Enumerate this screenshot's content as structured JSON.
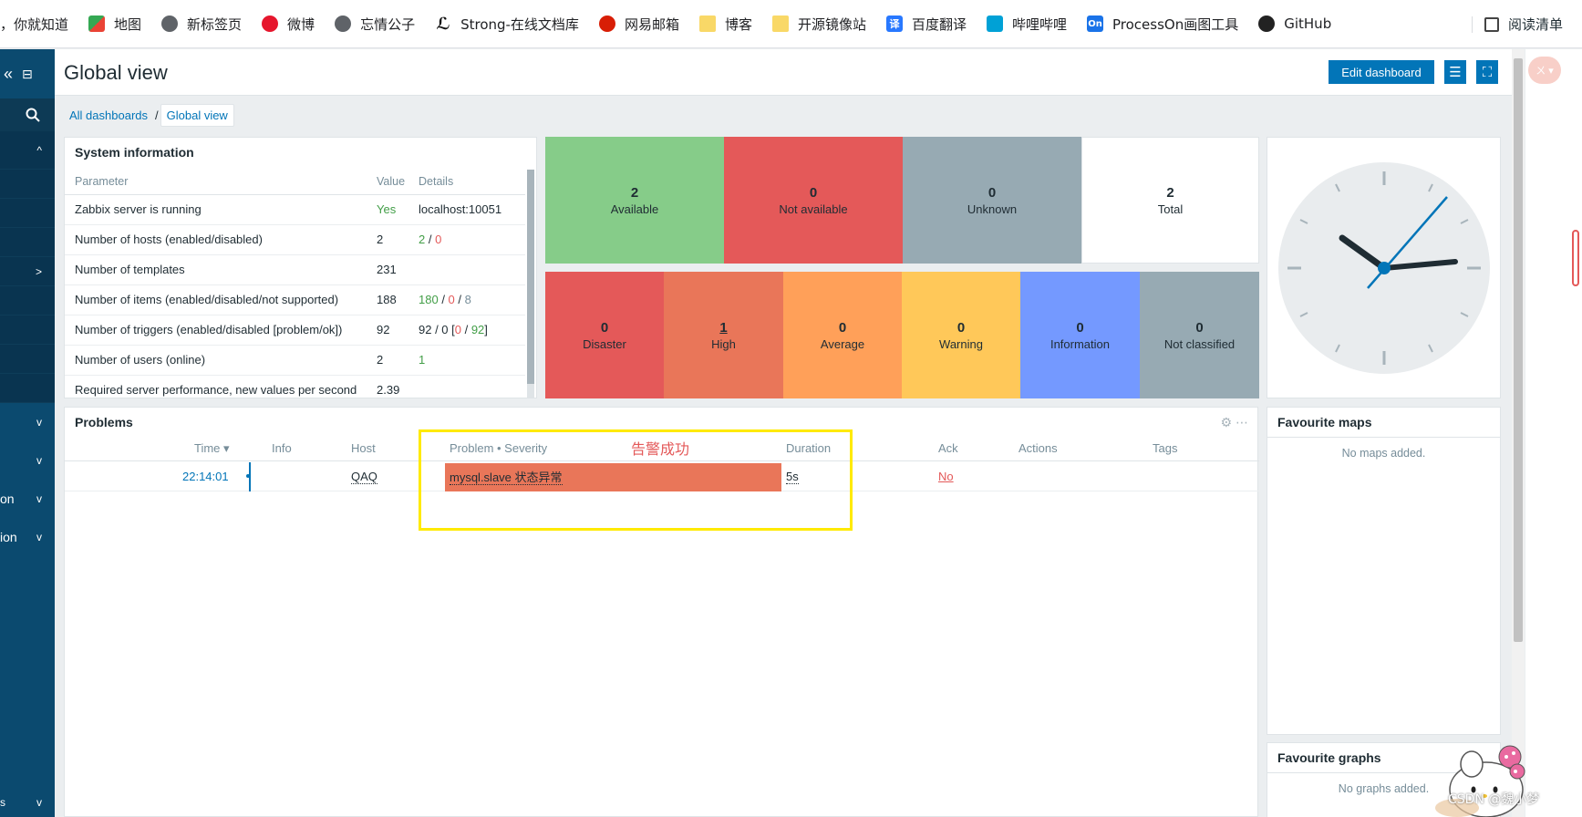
{
  "bookmarks": [
    {
      "label": "，你就知道",
      "icon": "none"
    },
    {
      "label": "地图",
      "icon": "map"
    },
    {
      "label": "新标签页",
      "icon": "globe"
    },
    {
      "label": "微博",
      "icon": "weibo"
    },
    {
      "label": "忘情公子",
      "icon": "globe"
    },
    {
      "label": "Strong-在线文档库",
      "icon": "strong"
    },
    {
      "label": "网易邮箱",
      "icon": "mail"
    },
    {
      "label": "博客",
      "icon": "folder"
    },
    {
      "label": "开源镜像站",
      "icon": "folder"
    },
    {
      "label": "百度翻译",
      "icon": "fanyi"
    },
    {
      "label": "哔哩哔哩",
      "icon": "bili"
    },
    {
      "label": "ProcessOn画图工具",
      "icon": "on"
    },
    {
      "label": "GitHub",
      "icon": "gh"
    }
  ],
  "bookmark_icon_text": {
    "fanyi": "译",
    "on": "On"
  },
  "reading_list": "阅读清单",
  "sidebar": {
    "items": [
      {
        "label": "",
        "arrow": "^"
      },
      {
        "label": "",
        "arrow": ""
      },
      {
        "label": "",
        "arrow": ""
      },
      {
        "label": "",
        "arrow": ""
      },
      {
        "label": "",
        "arrow": ">"
      },
      {
        "label": "",
        "arrow": ""
      },
      {
        "label": "",
        "arrow": ""
      },
      {
        "label": "",
        "arrow": ""
      },
      {
        "label": "",
        "arrow": ""
      },
      {
        "label": "",
        "arrow": "v"
      },
      {
        "label": "",
        "arrow": "v"
      },
      {
        "label": "on",
        "arrow": "v"
      },
      {
        "label": "ion",
        "arrow": "v"
      }
    ],
    "bottom_label": "s"
  },
  "header": {
    "title": "Global view",
    "edit_button": "Edit dashboard"
  },
  "breadcrumb": {
    "root": "All dashboards",
    "separator": "/",
    "current": "Global view"
  },
  "system_info": {
    "title": "System information",
    "columns": [
      "Parameter",
      "Value",
      "Details"
    ],
    "rows": [
      {
        "param": "Zabbix server is running",
        "value": "Yes",
        "details": "localhost:10051"
      },
      {
        "param": "Number of hosts (enabled/disabled)",
        "value": "2",
        "d1": "2",
        "d2": "0"
      },
      {
        "param": "Number of templates",
        "value": "231",
        "details": ""
      },
      {
        "param": "Number of items (enabled/disabled/not supported)",
        "value": "188",
        "d1": "180",
        "d2": "0",
        "d3": "8"
      },
      {
        "param": "Number of triggers (enabled/disabled [problem/ok])",
        "value": "92",
        "t1": "92 / 0 [",
        "t2": "0",
        "t3": " / ",
        "t4": "92",
        "t5": "]"
      },
      {
        "param": "Number of users (online)",
        "value": "2",
        "d1": "1"
      },
      {
        "param": "Required server performance, new values per second",
        "value": "2.39",
        "details": ""
      }
    ]
  },
  "host_availability": [
    {
      "count": "2",
      "label": "Available",
      "color": "#86cc89"
    },
    {
      "count": "0",
      "label": "Not available",
      "color": "#e45959"
    },
    {
      "count": "0",
      "label": "Unknown",
      "color": "#97aab3"
    },
    {
      "count": "2",
      "label": "Total",
      "color": "#ffffff"
    }
  ],
  "severity_tiles": [
    {
      "count": "0",
      "label": "Disaster",
      "color": "#e45959"
    },
    {
      "count": "1",
      "label": "High",
      "color": "#e97659"
    },
    {
      "count": "0",
      "label": "Average",
      "color": "#ffa059"
    },
    {
      "count": "0",
      "label": "Warning",
      "color": "#ffc859"
    },
    {
      "count": "0",
      "label": "Information",
      "color": "#7499ff"
    },
    {
      "count": "0",
      "label": "Not classified",
      "color": "#97aab3"
    }
  ],
  "problems": {
    "title": "Problems",
    "columns": {
      "time": "Time ▾",
      "info": "Info",
      "host": "Host",
      "problem": "Problem • Severity",
      "duration": "Duration",
      "ack": "Ack",
      "actions": "Actions",
      "tags": "Tags"
    },
    "rows": [
      {
        "time": "22:14:01",
        "host": "QAQ",
        "problem": "mysql.slave 状态异常",
        "duration": "5s",
        "ack": "No"
      }
    ]
  },
  "annotation": "告警成功",
  "fav_maps": {
    "title": "Favourite maps",
    "empty": "No maps added."
  },
  "fav_graphs": {
    "title": "Favourite graphs",
    "empty": "No graphs added."
  },
  "watermark": "CSDN @魏小梦",
  "right_pill": "ㄨ ▾"
}
